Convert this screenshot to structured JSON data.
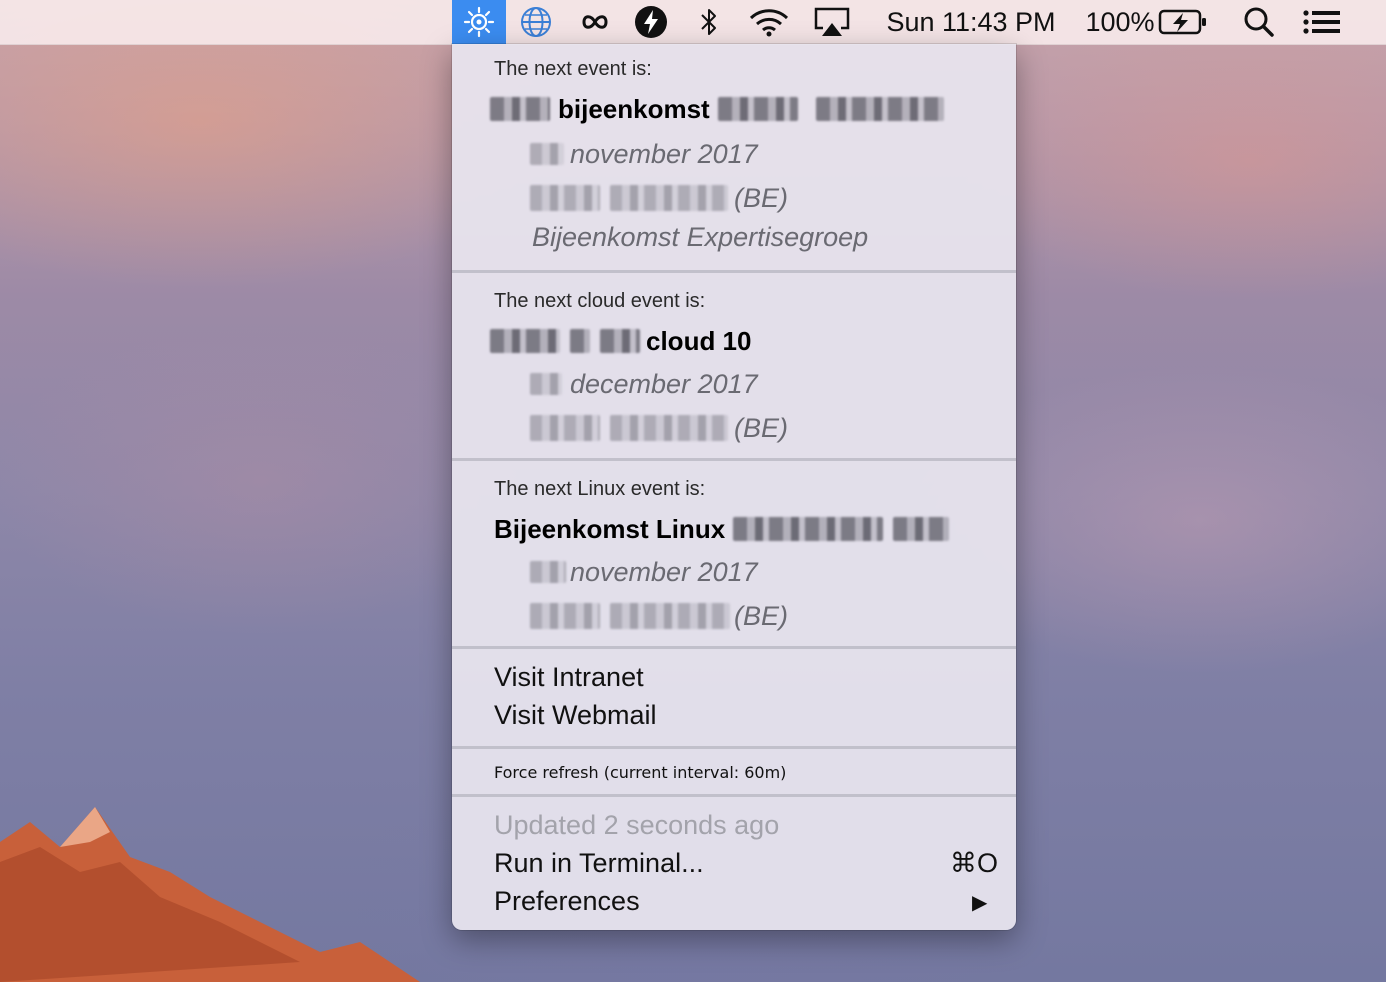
{
  "menubar": {
    "clock": "Sun 11:43 PM",
    "battery": "100%"
  },
  "sections": [
    {
      "header": "The next event is:",
      "title": "bijeenkomst",
      "date": "november 2017",
      "location": "(BE)",
      "description": "Bijeenkomst Expertisegroep"
    },
    {
      "header": "The next cloud event is:",
      "title": "cloud 10",
      "date": "december 2017",
      "location": "(BE)"
    },
    {
      "header": "The next Linux event is:",
      "title": "Bijeenkomst Linux",
      "date": "november 2017",
      "location": "(BE)"
    }
  ],
  "links": {
    "intranet": "Visit Intranet",
    "webmail": "Visit Webmail"
  },
  "refresh": {
    "label": "Force refresh (current interval: 60m)"
  },
  "footer": {
    "updated": "Updated 2 seconds ago",
    "run_terminal": "Run in Terminal...",
    "run_shortcut": "⌘O",
    "preferences": "Preferences",
    "submenu_arrow": "▶"
  }
}
